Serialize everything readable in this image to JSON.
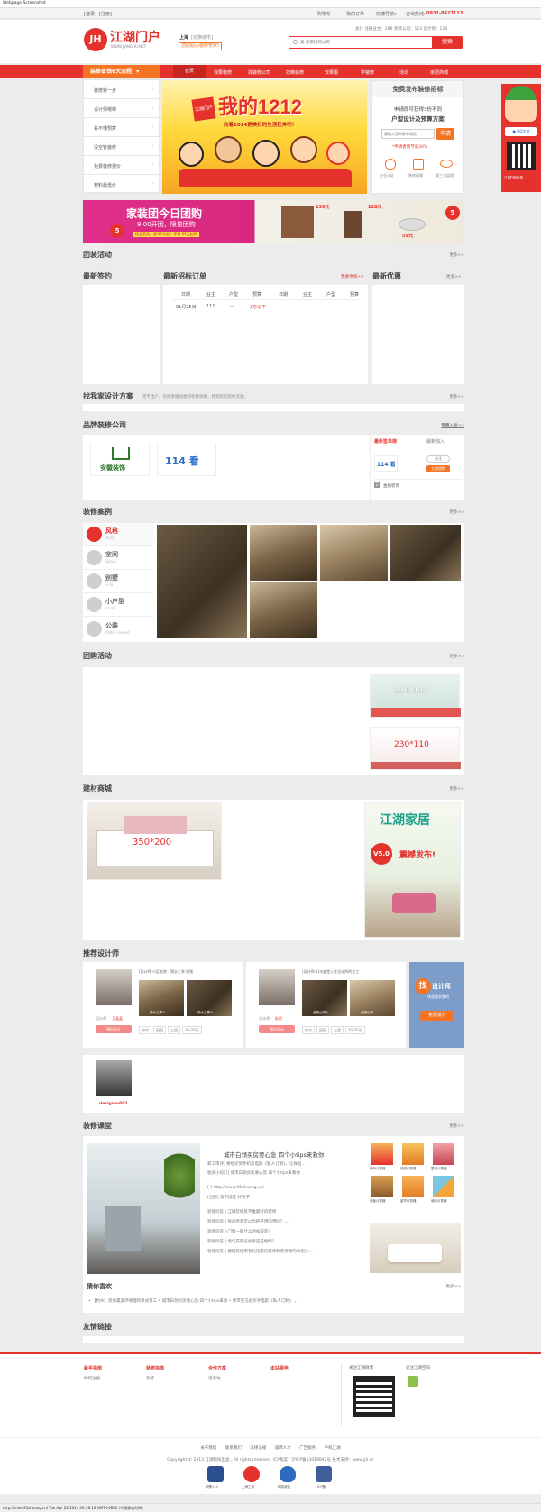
{
  "screenshot_label": "Webpage Screenshot",
  "topbar": {
    "login": "[登录]",
    "register": "[注册]",
    "cart": "购物车",
    "orders": "我的订单",
    "quick_nav": "快捷导航▾",
    "hotline_label": "咨询热线:",
    "hotline": "0931-8427113"
  },
  "header": {
    "logo_text": "江湖门户",
    "logo_url": "WWW.JIANGHU.NET",
    "city": "上海",
    "city_switch": "[切换城市]",
    "slogan": "您的贴心装修管家!",
    "stats": "总计 注册业主：286  装修公司：123  设计师：124",
    "search_placeholder": "美 您要搜的公司",
    "search_button": "搜索"
  },
  "nav": {
    "process_label": "装修省钱6大流程",
    "items": [
      "首页",
      "我要装修",
      "找装修公司",
      "找精装修",
      "效果图",
      "学装修",
      "活动",
      "家居商城"
    ]
  },
  "sidebar_steps": [
    "装修第一步",
    "设计师嗯嗯",
    "看不懂预算",
    "没空管装修",
    "免费装修报价",
    "材料最低价"
  ],
  "banner": {
    "badge": "江湖门户",
    "headline": "我的1212",
    "subline": "向着2014更美好的生活狂奔吧！"
  },
  "free_quote": {
    "title": "免费发布装修招标",
    "line1": "申请即可获得3份不同",
    "line2": "户型设计及预算方案",
    "input_placeholder": "请输入您的联系电话",
    "apply_button": "申请",
    "note": "*申请者将节省30%",
    "icons": [
      "企业认证",
      "装修保障",
      "第三方监理"
    ]
  },
  "group_banner": {
    "title": "家装团今日团购",
    "time": "9:00开团，限量团购",
    "note": "精品家具、瓷砖5折起！家装 55元起购",
    "price1": "139元",
    "price2": "118元",
    "price3": "59元"
  },
  "sections": {
    "tuangou": "团装活动",
    "sign": "最新签约",
    "bid": "最新招标订单",
    "bid_apply": "我要申请>>",
    "offer": "最新优惠",
    "design": "找我家设计方案",
    "design_sub": "足不出户，在线参观同类的装修效果，找到您的装修灵感。",
    "brand": "品牌装修公司",
    "brand_join": "我要入驻>>",
    "cases": "装修案例",
    "groupbuy": "团购活动",
    "mall": "建材商城",
    "designers": "推荐设计师",
    "school": "装修课堂",
    "guess": "猜你喜欢",
    "links": "友情链接",
    "more": "更多>>"
  },
  "bid_table": {
    "headers": [
      "日期",
      "业主",
      "户型",
      "预算",
      "日期",
      "业主",
      "户型",
      "预算"
    ],
    "rows": [
      [
        "01月25日",
        "111",
        "---",
        "3万以下"
      ]
    ]
  },
  "brand_box": {
    "logo1": "安徽装饰",
    "logo2": "114 看",
    "tab1": "最新签单榜",
    "tab2": "最新加入",
    "company": "114 看",
    "visit": "立即团购",
    "follow": "关注",
    "rank_num": "2",
    "rank_name": "金福装饰"
  },
  "case_styles": [
    {
      "cn": "风格",
      "en": "style"
    },
    {
      "cn": "空间",
      "en": "Space"
    },
    {
      "cn": "别墅",
      "en": "villa"
    },
    {
      "cn": "小户型",
      "en": "small"
    },
    {
      "cn": "公装",
      "en": "Public loaded"
    }
  ],
  "groupbuy_ads": [
    "230*110",
    "230*110"
  ],
  "mall": {
    "product_size": "350*200",
    "ad_title": "江湖家居",
    "ad_sub": "震撼发布!",
    "ad_version": "V5.0"
  },
  "designers": [
    {
      "desc": "[设计师-小区名称：锦水三季 原版",
      "label_name": "设计师：",
      "name": "王晶晶",
      "button": "预约设计",
      "thumbs": [
        "锦水三季①",
        "锦水三季②"
      ],
      "tags": [
        "中式",
        "田园",
        "三居",
        "10-20万"
      ]
    },
    {
      "desc": "[设计师-1]丰盛堂入驻设计所的总工",
      "label_name": "设计师：",
      "name": "彩色",
      "button": "预约设计",
      "thumbs": [
        "金鼎公寓②",
        "金鼎公寓"
      ],
      "tags": [
        "中式",
        "田园",
        "三居",
        "10-20万"
      ]
    }
  ],
  "find_designer": {
    "t1": "找",
    "t2": "设计师",
    "t3": "快速找到我的",
    "button": "免费设计"
  },
  "designer_extra": {
    "name": "designer001"
  },
  "school": {
    "headline": "城市白领买房要心急 四个小tips来救你",
    "intro1": "新工审评] 要想买到手机卖电影《私人订制》，让样品...",
    "intro2": "收房小窍门] 城市白领买房要心急 四个小tips来救你",
    "url": "[-] http://www.95zhuang.cn/",
    "tip": "[合肥] 窗帘搭配 好房子",
    "list": [
      "装修问答 | 江城装修某不推最好的装修",
      "装修问答 | 驾驶所装可以当柜子用的用吗？...",
      "装修问答 | 门和一般什么时候安装？",
      "装修问答 | 墙气开裂该补修还是继续？",
      "装修问答 | 建筑装修用有包括家的装饰和装修物的水泥沙..."
    ],
    "icons": [
      "涂料计算器",
      "墙纸计算器",
      "壁纸计算器",
      "地板计算器",
      "窗帘计算器",
      "墙砖计算器"
    ]
  },
  "guess": {
    "text": "• 【杭州】装修最美环保理的单式开工 •  城市白领买房要心急 四个小tips来救 •  要带亚马逊买手电影《私人订制》 。"
  },
  "footer": {
    "cols": [
      {
        "title": "新手指南",
        "items": [
          "如何注册"
        ]
      },
      {
        "title": "装修指南",
        "items": [
          "装修"
        ]
      },
      {
        "title": "合作方案",
        "items": [
          "话说坊"
        ]
      },
      {
        "title": "本站服务",
        "items": []
      }
    ],
    "weibo": "关注江湖微博",
    "wechat": "关注江湖空间",
    "links": [
      "关于我们",
      "联系我们",
      "法律法规",
      "诚聘人才",
      "广告服务",
      "手机江湖"
    ],
    "copyright": "Copyright © 2013  江湖科技出品 , All rights reserved. ICP备案：沪ICP备13018842号 技术支持：www.jjh.cc",
    "badges": [
      "网警110",
      "上海工商",
      "网络诚信",
      "ICP备"
    ]
  },
  "side_float": {
    "qq": "QQ交谈",
    "qr_label": "江湖扫码优惠"
  },
  "statusbar": "http://shuk.95zhuang.cn/ Tue Apr 22 2014 09:58:16 GMT+0800 (中国标准时间)"
}
